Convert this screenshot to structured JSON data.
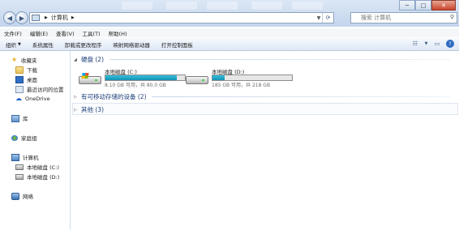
{
  "address": {
    "segments": [
      "计算机"
    ],
    "search_placeholder": "搜索 计算机"
  },
  "window_controls": {
    "minimize": "─",
    "maximize": "□",
    "close": "✕"
  },
  "menu": [
    "文件(F)",
    "编辑(E)",
    "查看(V)",
    "工具(T)",
    "帮助(H)"
  ],
  "toolbar": {
    "organize": "组织",
    "commands": [
      "系统属性",
      "卸载或更改程序",
      "映射网络驱动器",
      "打开控制面板"
    ]
  },
  "sidebar": {
    "favorites": {
      "label": "收藏夹",
      "items": [
        "下载",
        "桌面",
        "最近访问的位置",
        "OneDrive"
      ]
    },
    "libraries": "库",
    "homegroup": "家庭组",
    "computer": {
      "label": "计算机",
      "items": [
        "本地磁盘 (C:)",
        "本地磁盘 (D:)"
      ]
    },
    "network": "网络"
  },
  "content": {
    "hard_disks_header": "硬盘 (2)",
    "removable_header": "有可移动存储的设备 (2)",
    "other_header": "其他 (3)",
    "drives": [
      {
        "name": "本地磁盘 (C:)",
        "free_text": "8.10 GB 可用，共 80.0 GB",
        "used_fraction": 0.9
      },
      {
        "name": "本地磁盘 (D:)",
        "free_text": "185 GB 可用，共 218 GB",
        "used_fraction": 0.15
      }
    ]
  }
}
